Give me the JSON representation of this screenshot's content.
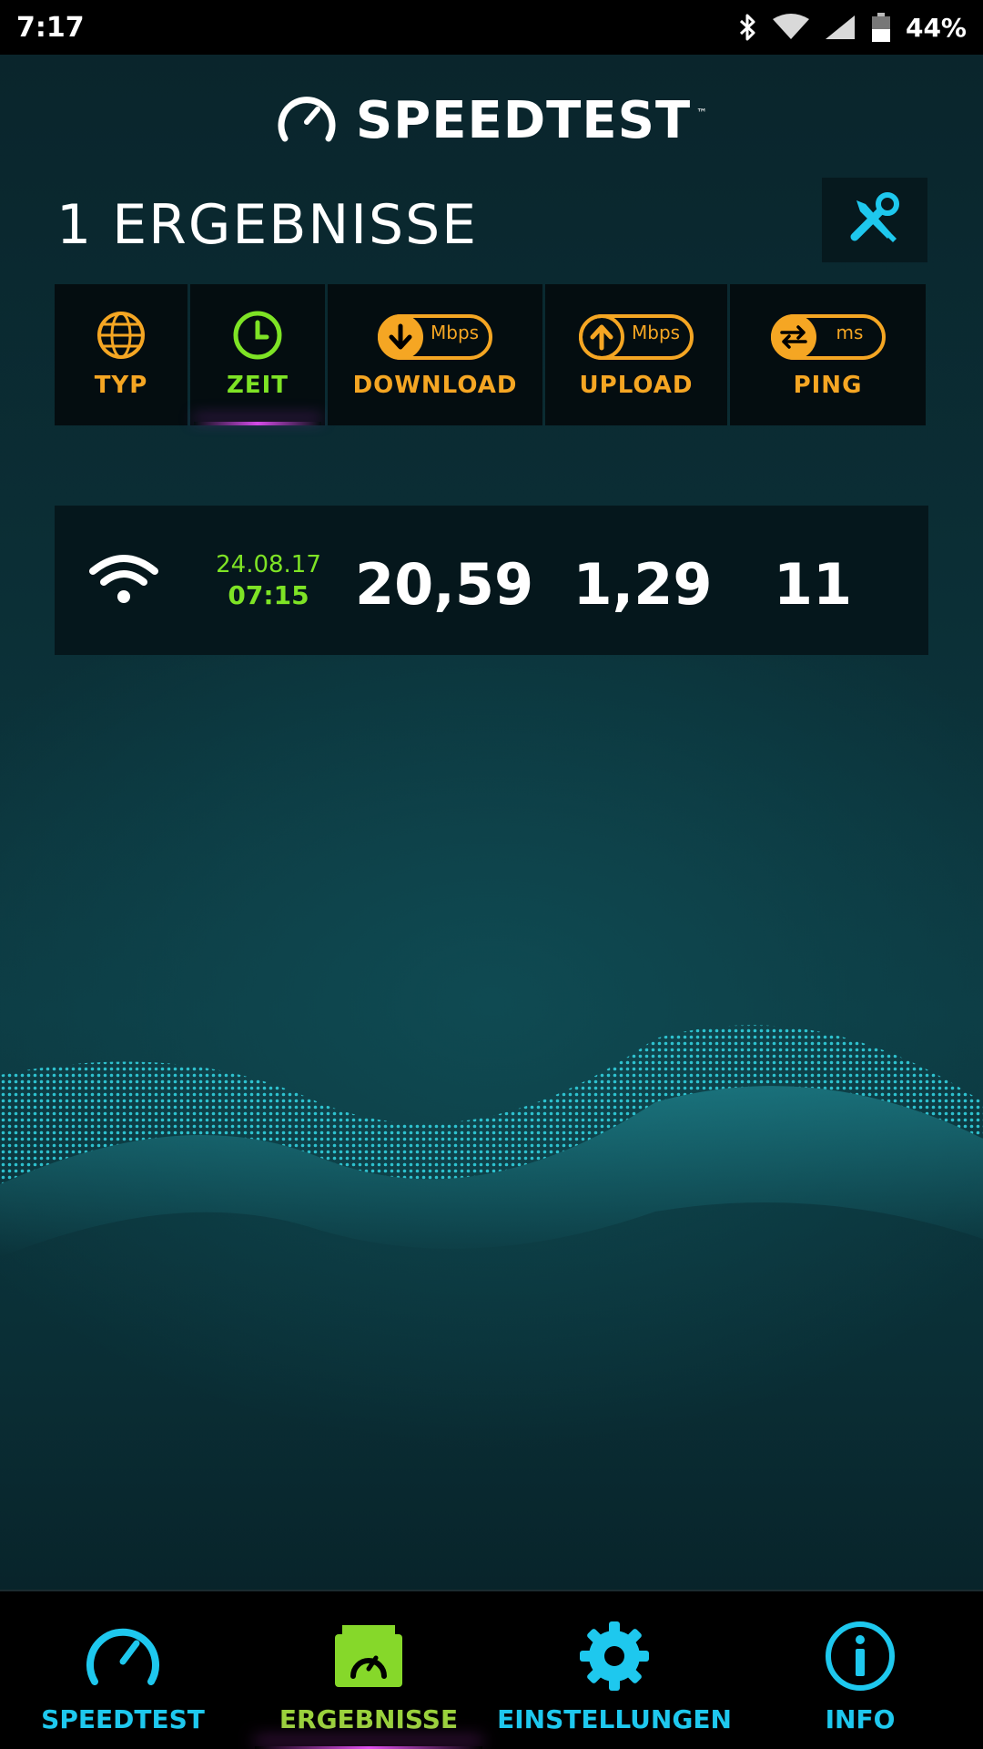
{
  "status_bar": {
    "time": "7:17",
    "battery": "44%",
    "icons": [
      "bluetooth-icon",
      "wifi-icon",
      "signal-icon",
      "battery-icon"
    ]
  },
  "header": {
    "brand": "SPEEDTEST",
    "trademark": "™",
    "logo_icon": "speedometer-icon"
  },
  "results": {
    "title": "1 ERGEBNISSE",
    "tools_icon": "tools-icon",
    "columns": [
      {
        "label": "TYP",
        "icon": "globe-icon"
      },
      {
        "label": "ZEIT",
        "icon": "clock-icon",
        "active": true
      },
      {
        "label": "DOWNLOAD",
        "icon": "download-icon",
        "unit": "Mbps"
      },
      {
        "label": "UPLOAD",
        "icon": "upload-icon",
        "unit": "Mbps"
      },
      {
        "label": "PING",
        "icon": "ping-icon",
        "unit": "ms"
      }
    ],
    "rows": [
      {
        "type_icon": "wifi-icon",
        "date": "24.08.17",
        "time": "07:15",
        "download": "20,59",
        "upload": "1,29",
        "ping": "11"
      }
    ]
  },
  "bottom_nav": [
    {
      "label": "SPEEDTEST",
      "icon": "speedometer-icon"
    },
    {
      "label": "ERGEBNISSE",
      "icon": "results-folder-icon",
      "active": true
    },
    {
      "label": "EINSTELLUNGEN",
      "icon": "gear-icon"
    },
    {
      "label": "INFO",
      "icon": "info-icon"
    }
  ],
  "colors": {
    "accent_orange": "#f5a623",
    "accent_green": "#7ee325",
    "accent_cyan": "#1ec8ee",
    "active_glow": "#d34ae8"
  }
}
